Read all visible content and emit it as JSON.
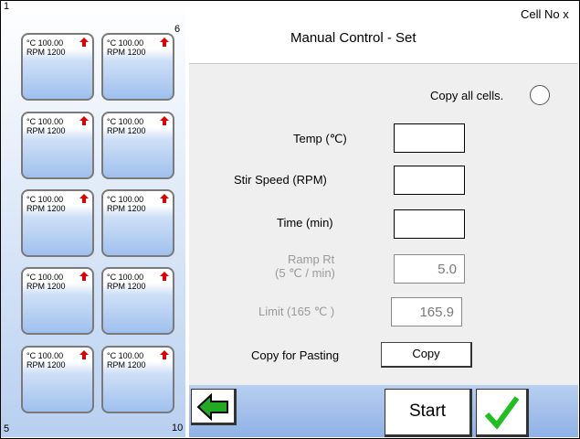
{
  "header": {
    "title": "Manual Control - Set",
    "cell_no": "Cell No  x"
  },
  "grid": {
    "top_left": "1",
    "top_right": "6",
    "bottom_left": "5",
    "bottom_right": "10",
    "cells": [
      {
        "temp": "°C 100.00",
        "rpm": "RPM 1200"
      },
      {
        "temp": "°C 100.00",
        "rpm": "RPM 1200"
      },
      {
        "temp": "°C 100.00",
        "rpm": "RPM 1200"
      },
      {
        "temp": "°C 100.00",
        "rpm": "RPM 1200"
      },
      {
        "temp": "°C 100.00",
        "rpm": "RPM 1200"
      },
      {
        "temp": "°C 100.00",
        "rpm": "RPM 1200"
      },
      {
        "temp": "°C 100.00",
        "rpm": "RPM 1200"
      },
      {
        "temp": "°C 100.00",
        "rpm": "RPM 1200"
      },
      {
        "temp": "°C 100.00",
        "rpm": "RPM 1200"
      },
      {
        "temp": "°C 100.00",
        "rpm": "RPM 1200"
      }
    ]
  },
  "form": {
    "copy_all_label": "Copy all cells.",
    "temp_label": "Temp (℃)",
    "temp_value": "",
    "stir_label": "Stir Speed (RPM)",
    "stir_value": "",
    "time_label": "Time (min)",
    "time_value": "",
    "ramp_label_1": "Ramp Rt",
    "ramp_label_2": "(5 ℃ / min)",
    "ramp_value": "5.0",
    "limit_label": "Limit (165 ℃ )",
    "limit_value": "165.9",
    "copy_paste_label": "Copy for Pasting",
    "copy_button": "Copy"
  },
  "footer": {
    "start_button": "Start"
  },
  "colors": {
    "arrow_red": "#e00000",
    "back_green": "#22aa22",
    "check_green": "#1fbf1f"
  },
  "icons": {
    "back": "green-left-arrow-icon",
    "confirm": "green-check-icon",
    "cell_status": "red-up-arrow-icon"
  }
}
